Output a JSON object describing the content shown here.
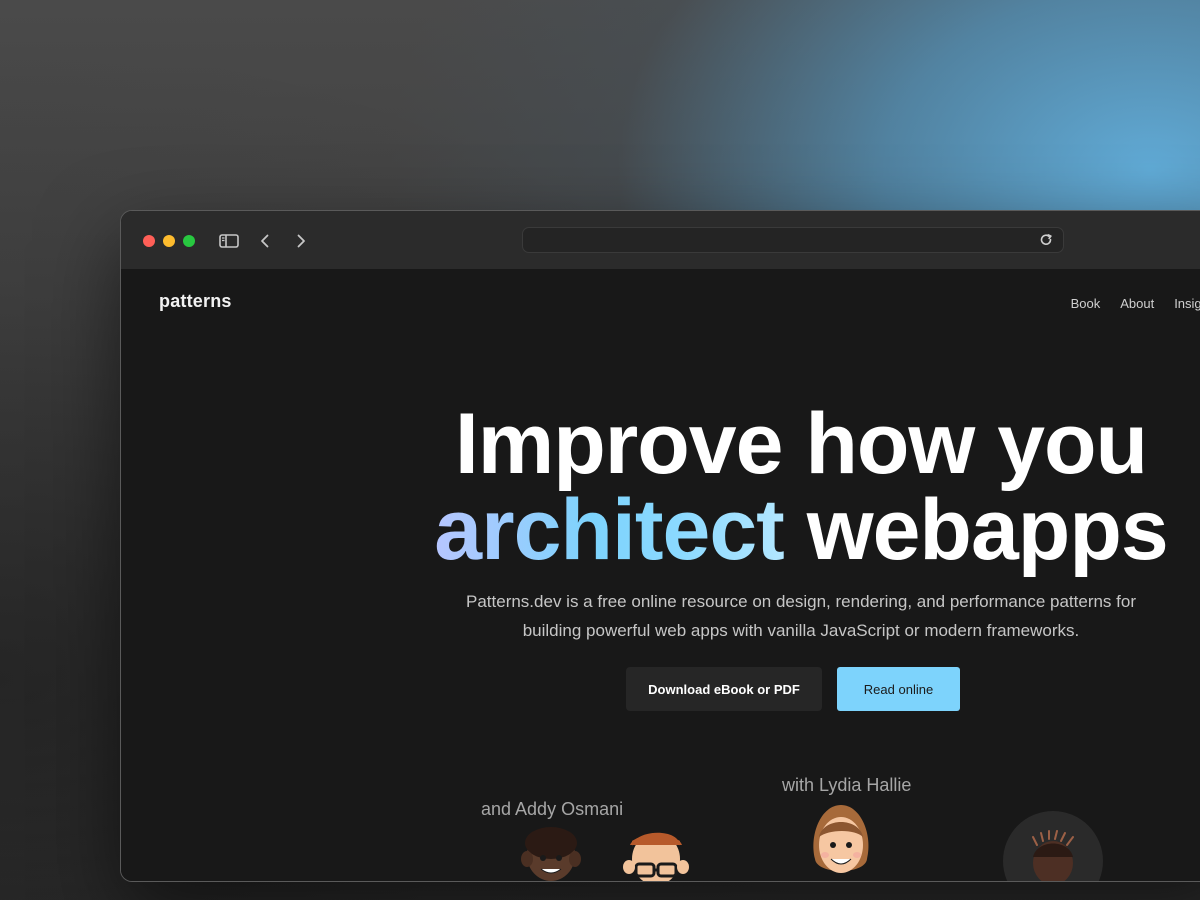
{
  "site": {
    "logo": "patterns",
    "nav": [
      {
        "label": "Book"
      },
      {
        "label": "About"
      },
      {
        "label": "Insights"
      }
    ],
    "hero": {
      "line1": "Improve how you",
      "line2_accent": "architect",
      "line2_rest": "webapps",
      "subtitle_line1": "Patterns.dev is a free online resource on design, rendering, and performance patterns for",
      "subtitle_line2": "building powerful web apps with vanilla JavaScript or modern frameworks."
    },
    "buttons": {
      "download": "Download eBook or PDF",
      "read_online": "Read online"
    },
    "credits": {
      "addy": "and Addy Osmani",
      "lydia": "with Lydia Hallie"
    }
  },
  "colors": {
    "accent": "#7dd3fc",
    "page_background": "#181818",
    "titlebar": "#2b2b2b"
  },
  "icons": {
    "sidebar": "sidebar-toggle-icon",
    "back": "chevron-left-icon",
    "forward": "chevron-right-icon",
    "reload": "reload-icon"
  }
}
